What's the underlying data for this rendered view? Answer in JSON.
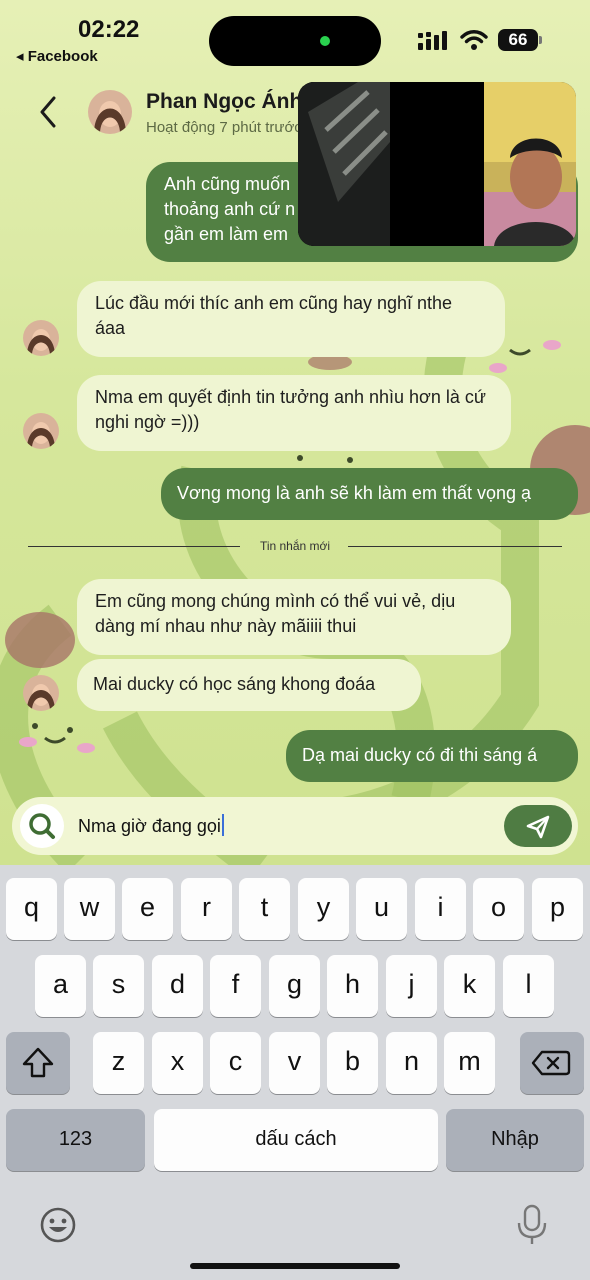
{
  "status_bar": {
    "time": "02:22",
    "back_app": "Facebook",
    "battery": "66"
  },
  "header": {
    "contact_name": "Phan Ngọc Ánh",
    "contact_status": "Hoạt động 7 phút trước"
  },
  "messages": [
    {
      "direction": "out",
      "text": "Anh cũng muốn\nthoảng anh cứ n\ngần em làm em"
    },
    {
      "direction": "in",
      "text": "Lúc đầu mới thíc anh em cũng hay nghĩ nthe áaa"
    },
    {
      "direction": "in",
      "text": "Nma em quyết định tin tưởng anh nhìu hơn là cứ nghi ngờ =)))"
    },
    {
      "direction": "out",
      "text": "Vơng mong là anh sẽ kh làm em thất vọng ạ"
    },
    {
      "direction": "in",
      "text": "Em cũng mong chúng mình có thể vui vẻ, dịu dàng mí nhau như này mãiiii thui"
    },
    {
      "direction": "in",
      "text": "Mai ducky có học sáng khong đoáa"
    },
    {
      "direction": "out",
      "text": "Dạ mai ducky có đi thi sáng á"
    }
  ],
  "divider_label": "Tin nhắn mới",
  "composer": {
    "value": "Nma giờ đang gọi"
  },
  "keyboard": {
    "row1": [
      "q",
      "w",
      "e",
      "r",
      "t",
      "y",
      "u",
      "i",
      "o",
      "p"
    ],
    "row2": [
      "a",
      "s",
      "d",
      "f",
      "g",
      "h",
      "j",
      "k",
      "l"
    ],
    "row3": [
      "z",
      "x",
      "c",
      "v",
      "b",
      "n",
      "m"
    ],
    "numbers_label": "123",
    "space_label": "dấu cách",
    "return_label": "Nhập"
  },
  "icons": [
    "back-chevron-icon",
    "search-icon",
    "send-icon",
    "shift-icon",
    "backspace-icon",
    "emoji-icon",
    "microphone-icon",
    "signal-icon",
    "wifi-icon"
  ],
  "colors": {
    "outgoing_bubble": "#528043",
    "incoming_bubble": "#eff5d2",
    "chat_background": "#d6e79c",
    "keyboard_background": "#d6d8dc"
  }
}
